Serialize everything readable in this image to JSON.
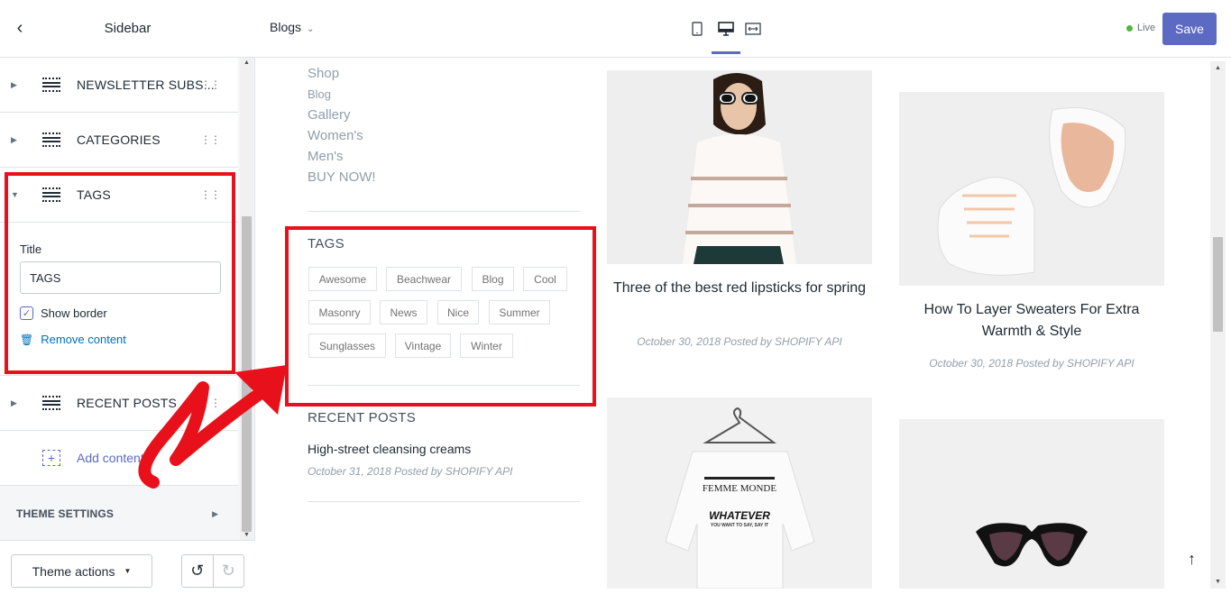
{
  "sidebar": {
    "title": "Sidebar",
    "sections": [
      {
        "label": "NEWSLETTER SUBS..."
      },
      {
        "label": "CATEGORIES"
      },
      {
        "label": "TAGS"
      },
      {
        "label": "RECENT POSTS"
      }
    ],
    "tags_settings": {
      "title_label": "Title",
      "title_value": "TAGS",
      "show_border_label": "Show border",
      "show_border_checked": true,
      "remove_label": "Remove content"
    },
    "add_content_label": "Add content",
    "theme_settings_label": "THEME SETTINGS",
    "theme_actions_label": "Theme actions"
  },
  "topbar": {
    "page_select": "Blogs",
    "live_label": "Live",
    "save_label": "Save"
  },
  "preview": {
    "menu_links": [
      "Shop",
      "Blog",
      "Gallery",
      "Women's",
      "Men's",
      "BUY NOW!"
    ],
    "tags_title": "TAGS",
    "tags": [
      "Awesome",
      "Beachwear",
      "Blog",
      "Cool",
      "Masonry",
      "News",
      "Nice",
      "Summer",
      "Sunglasses",
      "Vintage",
      "Winter"
    ],
    "recent_posts_title": "RECENT POSTS",
    "recent_post": {
      "title": "High-street cleansing creams",
      "meta": "October 31, 2018 Posted by SHOPIFY API"
    },
    "posts": [
      {
        "title": "Three of the best red lipsticks for spring",
        "meta": "October 30, 2018 Posted by SHOPIFY API",
        "image": "woman-sweater-photo"
      },
      {
        "title": "How To Layer Sweaters For Extra Warmth & Style",
        "meta": "October 30, 2018 Posted by SHOPIFY API",
        "image": "white-sneaker-photo"
      },
      {
        "title": "",
        "meta": "",
        "image": "sweatshirt-hanger-photo",
        "print_brand": "FEMME MONDE",
        "print_slogan": "WHATEVER",
        "print_small": "YOU WANT TO SAY, SAY IT"
      },
      {
        "title": "",
        "meta": "",
        "image": "cat-eye-sunglasses-photo"
      }
    ]
  },
  "colors": {
    "accent": "#5c6ac4",
    "highlight": "#e8111b",
    "live": "#50b83c"
  }
}
